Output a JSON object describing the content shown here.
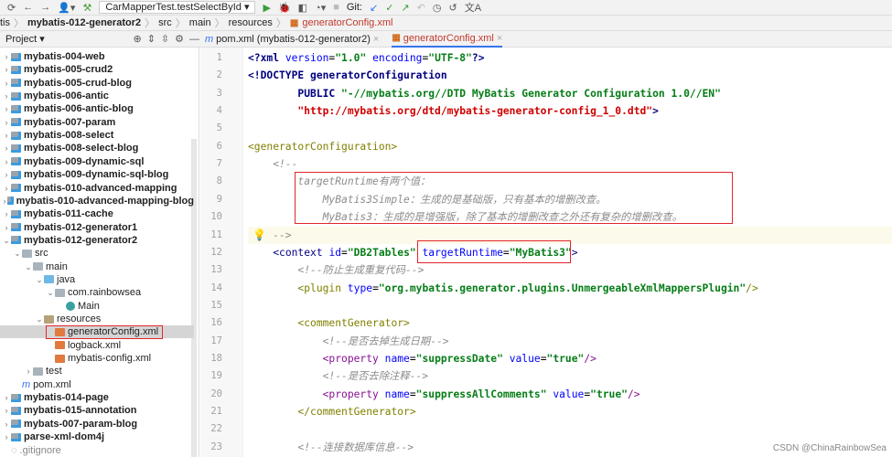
{
  "toolbar": {
    "run_config": "CarMapperTest.testSelectById",
    "git_label": "Git:"
  },
  "breadcrumb": [
    "tis",
    "mybatis-012-generator2",
    "src",
    "main",
    "resources",
    "generatorConfig.xml"
  ],
  "project_panel": {
    "title": "Project"
  },
  "tabs": [
    {
      "label": "pom.xml (mybatis-012-generator2)",
      "active": false
    },
    {
      "label": "generatorConfig.xml",
      "active": true
    }
  ],
  "tree": [
    {
      "label": "mybatis-004-web",
      "level": 0,
      "kind": "mod",
      "open": false
    },
    {
      "label": "mybatis-005-crud2",
      "level": 0,
      "kind": "mod",
      "open": false
    },
    {
      "label": "mybatis-005-crud-blog",
      "level": 0,
      "kind": "mod",
      "open": false
    },
    {
      "label": "mybatis-006-antic",
      "level": 0,
      "kind": "mod",
      "open": false
    },
    {
      "label": "mybatis-006-antic-blog",
      "level": 0,
      "kind": "mod",
      "open": false
    },
    {
      "label": "mybatis-007-param",
      "level": 0,
      "kind": "mod",
      "open": false
    },
    {
      "label": "mybatis-008-select",
      "level": 0,
      "kind": "mod",
      "open": false
    },
    {
      "label": "mybatis-008-select-blog",
      "level": 0,
      "kind": "mod",
      "open": false
    },
    {
      "label": "mybatis-009-dynamic-sql",
      "level": 0,
      "kind": "mod",
      "open": false
    },
    {
      "label": "mybatis-009-dynamic-sql-blog",
      "level": 0,
      "kind": "mod",
      "open": false
    },
    {
      "label": "mybatis-010-advanced-mapping",
      "level": 0,
      "kind": "mod",
      "open": false
    },
    {
      "label": "mybatis-010-advanced-mapping-blog",
      "level": 0,
      "kind": "mod",
      "open": false
    },
    {
      "label": "mybatis-011-cache",
      "level": 0,
      "kind": "mod",
      "open": false
    },
    {
      "label": "mybatis-012-generator1",
      "level": 0,
      "kind": "mod",
      "open": false
    },
    {
      "label": "mybatis-012-generator2",
      "level": 0,
      "kind": "mod",
      "open": true
    },
    {
      "label": "src",
      "level": 1,
      "kind": "fold",
      "open": true
    },
    {
      "label": "main",
      "level": 2,
      "kind": "fold",
      "open": true
    },
    {
      "label": "java",
      "level": 3,
      "kind": "src",
      "open": true
    },
    {
      "label": "com.rainbowsea",
      "level": 4,
      "kind": "fold",
      "open": true
    },
    {
      "label": "Main",
      "level": 5,
      "kind": "cls"
    },
    {
      "label": "resources",
      "level": 3,
      "kind": "res",
      "open": true
    },
    {
      "label": "generatorConfig.xml",
      "level": 4,
      "kind": "xmlf",
      "selected": true
    },
    {
      "label": "logback.xml",
      "level": 4,
      "kind": "xmlf"
    },
    {
      "label": "mybatis-config.xml",
      "level": 4,
      "kind": "xmlf"
    },
    {
      "label": "test",
      "level": 2,
      "kind": "fold",
      "open": false
    },
    {
      "label": "pom.xml",
      "level": 1,
      "kind": "pom"
    },
    {
      "label": "mybatis-014-page",
      "level": 0,
      "kind": "mod",
      "open": false
    },
    {
      "label": "mybatis-015-annotation",
      "level": 0,
      "kind": "mod",
      "open": false
    },
    {
      "label": "mybats-007-param-blog",
      "level": 0,
      "kind": "mod",
      "open": false
    },
    {
      "label": "parse-xml-dom4j",
      "level": 0,
      "kind": "mod",
      "open": false
    },
    {
      "label": ".gitignore",
      "level": 0,
      "kind": "file"
    }
  ],
  "code": [
    [
      [
        "decl",
        "<?xml "
      ],
      [
        "attr",
        "version"
      ],
      [
        "txt",
        "="
      ],
      [
        "str",
        "\"1.0\""
      ],
      [
        "txt",
        " "
      ],
      [
        "attr",
        "encoding"
      ],
      [
        "txt",
        "="
      ],
      [
        "str",
        "\"UTF-8\""
      ],
      [
        "decl",
        "?>"
      ]
    ],
    [
      [
        "decl",
        "<!DOCTYPE generatorConfiguration"
      ]
    ],
    [
      [
        "txt",
        "        "
      ],
      [
        "decl",
        "PUBLIC "
      ],
      [
        "str",
        "\"-//mybatis.org//DTD MyBatis Generator Configuration 1.0//EN\""
      ]
    ],
    [
      [
        "txt",
        "        "
      ],
      [
        "url",
        "\"http://mybatis.org/dtd/mybatis-generator-config_1_0.dtd\""
      ],
      [
        "decl",
        ">"
      ]
    ],
    [],
    [
      [
        "otag",
        "<generatorConfiguration>"
      ]
    ],
    [
      [
        "com",
        "    <!--"
      ]
    ],
    [
      [
        "com",
        "        targetRuntime有两个值："
      ]
    ],
    [
      [
        "com",
        "            MyBatis3Simple：生成的是基础版，只有基本的增删改查。"
      ]
    ],
    [
      [
        "com",
        "            MyBatis3：生成的是增强版，除了基本的增删改查之外还有复杂的增删改查。"
      ]
    ],
    [
      [
        "com",
        "    -->"
      ]
    ],
    [
      [
        "txt",
        "    "
      ],
      [
        "tag",
        "<context "
      ],
      [
        "attr",
        "id"
      ],
      [
        "txt",
        "="
      ],
      [
        "str",
        "\"DB2Tables\""
      ],
      [
        "txt",
        " "
      ],
      [
        "attr",
        "targetRuntime"
      ],
      [
        "txt",
        "="
      ],
      [
        "str",
        "\"MyBatis3\""
      ],
      [
        "tag",
        ">"
      ]
    ],
    [
      [
        "com",
        "        <!--防止生成重复代码-->"
      ]
    ],
    [
      [
        "txt",
        "        "
      ],
      [
        "otag",
        "<plugin "
      ],
      [
        "attr",
        "type"
      ],
      [
        "txt",
        "="
      ],
      [
        "str",
        "\"org.mybatis.generator.plugins.UnmergeableXmlMappersPlugin\""
      ],
      [
        "otag",
        "/>"
      ]
    ],
    [],
    [
      [
        "txt",
        "        "
      ],
      [
        "otag",
        "<commentGenerator>"
      ]
    ],
    [
      [
        "com",
        "            <!--是否去掉生成日期-->"
      ]
    ],
    [
      [
        "txt",
        "            "
      ],
      [
        "ptag",
        "<property "
      ],
      [
        "attr",
        "name"
      ],
      [
        "txt",
        "="
      ],
      [
        "str",
        "\"suppressDate\""
      ],
      [
        "txt",
        " "
      ],
      [
        "attr",
        "value"
      ],
      [
        "txt",
        "="
      ],
      [
        "str",
        "\"true\""
      ],
      [
        "ptag",
        "/>"
      ]
    ],
    [
      [
        "com",
        "            <!--是否去除注释-->"
      ]
    ],
    [
      [
        "txt",
        "            "
      ],
      [
        "ptag",
        "<property "
      ],
      [
        "attr",
        "name"
      ],
      [
        "txt",
        "="
      ],
      [
        "str",
        "\"suppressAllComments\""
      ],
      [
        "txt",
        " "
      ],
      [
        "attr",
        "value"
      ],
      [
        "txt",
        "="
      ],
      [
        "str",
        "\"true\""
      ],
      [
        "ptag",
        "/>"
      ]
    ],
    [
      [
        "txt",
        "        "
      ],
      [
        "otag",
        "</commentGenerator>"
      ]
    ],
    [],
    [
      [
        "com",
        "        <!--连接数据库信息-->"
      ]
    ]
  ],
  "watermark": "CSDN @ChinaRainbowSea"
}
